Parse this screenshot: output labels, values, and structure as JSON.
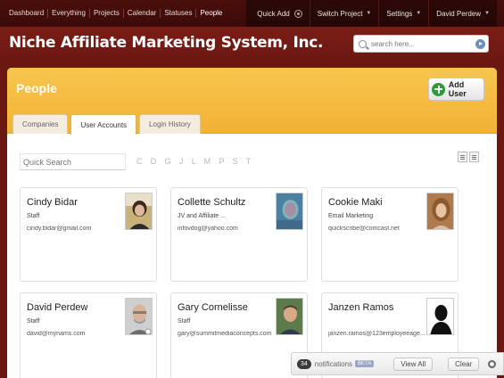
{
  "nav": {
    "left_items": [
      "Dashboard",
      "Everything",
      "Projects",
      "Calendar",
      "Statuses",
      "People"
    ],
    "quick_add": "Quick Add",
    "switch_project": "Switch Project",
    "settings": "Settings",
    "user": "David Perdew"
  },
  "header": {
    "title": "Niche Affiliate Marketing System, Inc.",
    "search_placeholder": "search here..."
  },
  "panel": {
    "title": "People",
    "add_user_label": "Add User",
    "tabs": [
      {
        "label": "Companies"
      },
      {
        "label": "User Accounts"
      },
      {
        "label": "Login History"
      }
    ],
    "quick_search_placeholder": "Quick Search",
    "letters": "C D G J L M P S T"
  },
  "users": [
    {
      "name": "Cindy Bidar",
      "role": "Staff",
      "email": "cindy.bidar@gmail.com"
    },
    {
      "name": "Collette Schultz",
      "role": "JV and Affiliate ...",
      "email": "infovdog@yahoo.com"
    },
    {
      "name": "Cookie Maki",
      "role": "Email Marketing",
      "email": "quickscribe@comcast.net"
    },
    {
      "name": "David Perdew",
      "role": "Staff",
      "email": "david@mynams.com"
    },
    {
      "name": "Gary Cornelisse",
      "role": "Staff",
      "email": "gary@summitmediaconcepts.com"
    },
    {
      "name": "Janzen Ramos",
      "role": "",
      "email": "janzen.ramos@123employeeage..."
    }
  ],
  "notifications": {
    "count": "34",
    "label": "notifications",
    "beta": "BETA",
    "view_all": "View All",
    "clear": "Clear"
  }
}
